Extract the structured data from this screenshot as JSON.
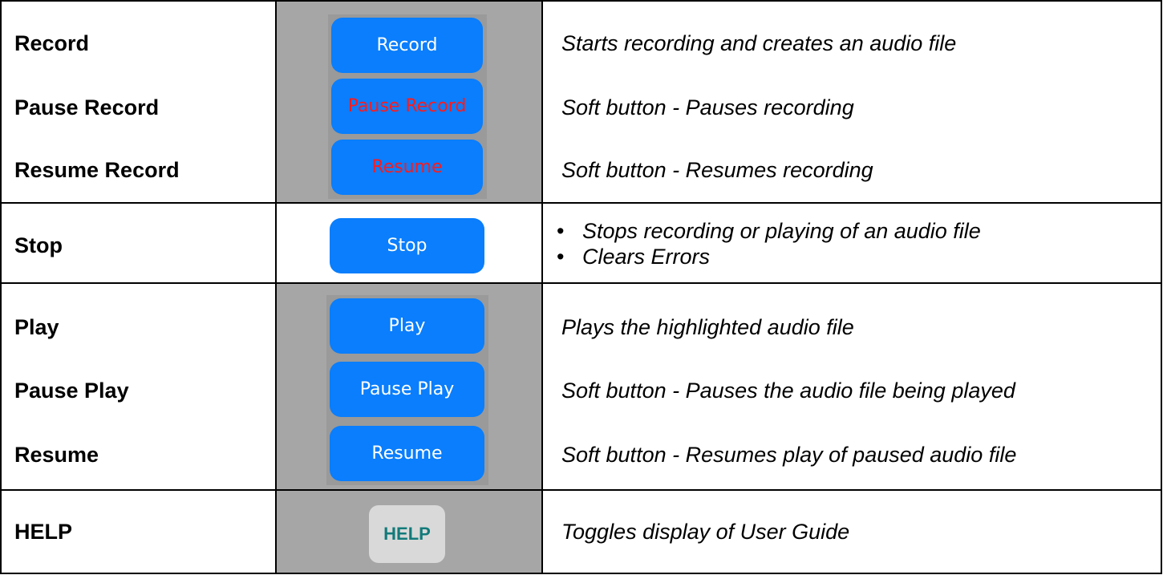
{
  "rows": {
    "record": {
      "label": "Record",
      "button": "Record",
      "desc": "Starts recording and creates an audio file"
    },
    "pause_record": {
      "label": "Pause Record",
      "button": "Pause Record",
      "desc": "Soft button - Pauses recording"
    },
    "resume_record": {
      "label": "Resume Record",
      "button": "Resume",
      "desc": "Soft button - Resumes recording"
    },
    "stop": {
      "label": "Stop",
      "button": "Stop",
      "bullets": [
        "Stops recording or playing of an audio file",
        "Clears Errors"
      ]
    },
    "play": {
      "label": "Play",
      "button": "Play",
      "desc": "Plays the highlighted audio file"
    },
    "pause_play": {
      "label": "Pause Play",
      "button": "Pause Play",
      "desc": "Soft button - Pauses the audio file being played"
    },
    "resume": {
      "label": "Resume",
      "button": "Resume",
      "desc": "Soft button - Resumes play of paused audio file"
    },
    "help": {
      "label": "HELP",
      "button": "HELP",
      "desc": "Toggles display of User Guide"
    }
  },
  "colors": {
    "button_blue": "#0a7efc",
    "soft_button_text": "#ff1a1a",
    "help_text": "#127a7a",
    "help_bg": "#d9d9d9",
    "cell_gray": "#a6a6a6"
  }
}
